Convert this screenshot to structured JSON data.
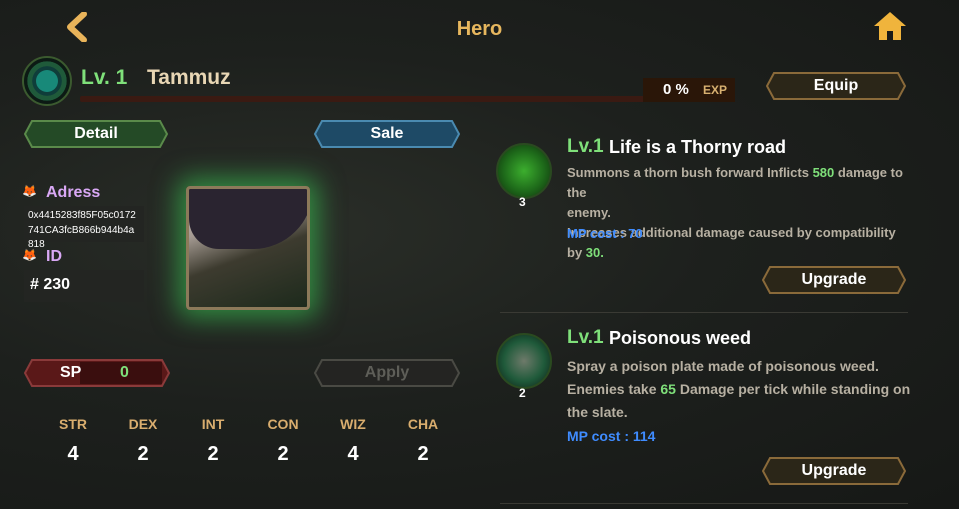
{
  "header": {
    "title": "Hero"
  },
  "hero": {
    "level": "Lv. 1",
    "name": "Tammuz",
    "exp_percent": "0 %",
    "exp_label": "EXP",
    "exp_fill": 0
  },
  "buttons": {
    "equip": "Equip",
    "detail": "Detail",
    "sale": "Sale",
    "apply": "Apply",
    "upgrade1": "Upgrade",
    "upgrade2": "Upgrade"
  },
  "info": {
    "address_label": "Adress",
    "address_lines": [
      "0x4415283f85F05c0172",
      "741CA3fcB866b944b4a",
      "818"
    ],
    "id_label": "ID",
    "id_value": "# 230"
  },
  "sp": {
    "label": "SP",
    "value": "0"
  },
  "stats": [
    {
      "name": "STR",
      "value": "4"
    },
    {
      "name": "DEX",
      "value": "2"
    },
    {
      "name": "INT",
      "value": "2"
    },
    {
      "name": "CON",
      "value": "2"
    },
    {
      "name": "WIZ",
      "value": "4"
    },
    {
      "name": "CHA",
      "value": "2"
    }
  ],
  "skills": [
    {
      "level": "Lv.1",
      "name": "Life is a Thorny road",
      "badge": "3",
      "line1_a": "Summons a thorn bush forward Inflicts ",
      "line1_num": "580",
      "line1_b": " damage to the",
      "line2": "enemy.",
      "line3_a": "Increases additional damage caused by compatibility by ",
      "line3_num": "30.",
      "mp_cost": "MP cost : 70"
    },
    {
      "level": "Lv.1",
      "name": "Poisonous weed",
      "badge": "2",
      "line1": "Spray a poison plate made of poisonous weed.",
      "line2_a": "Enemies take ",
      "line2_num": "65",
      "line2_b": " Damage per tick while standing on",
      "line3": "the slate.",
      "mp_cost": "MP cost : 114"
    }
  ],
  "colors": {
    "accent_gold": "#e7b75e",
    "level_green": "#7fe07a",
    "mp_blue": "#3f8cff",
    "glow_green": "#3cdc5a"
  }
}
